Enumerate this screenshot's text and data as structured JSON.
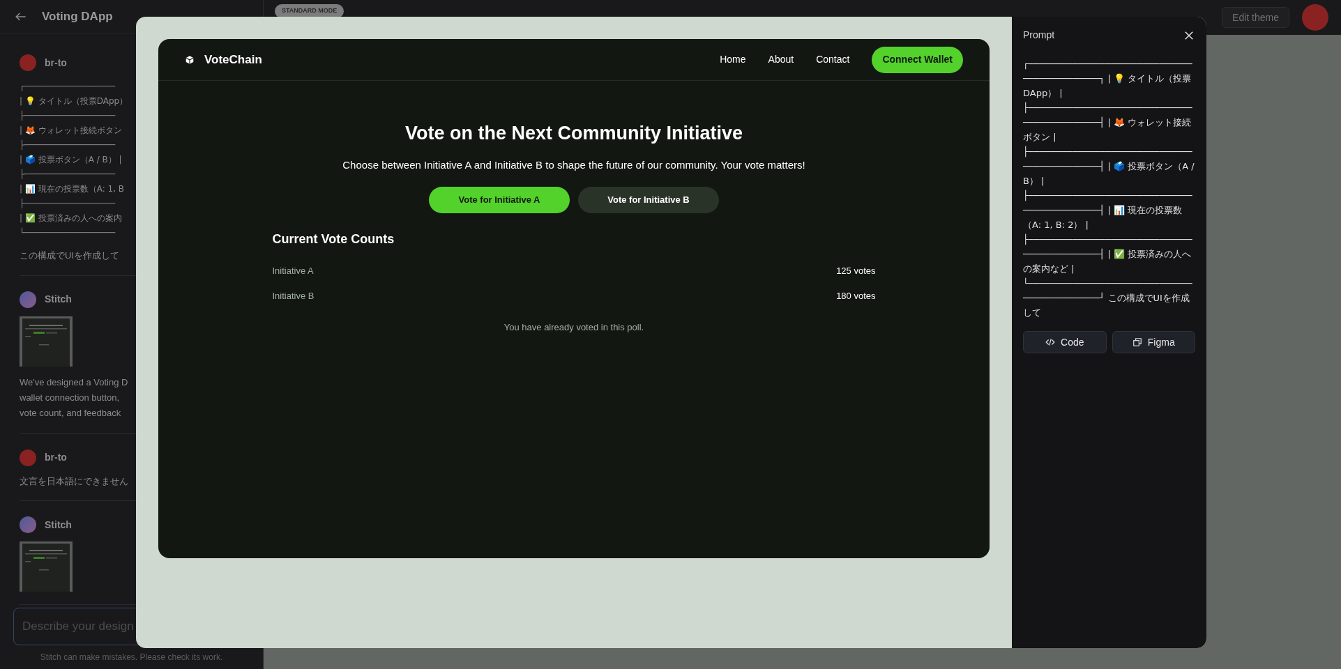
{
  "sidebar": {
    "title": "Voting DApp",
    "messages": [
      {
        "kind": "user",
        "author": "br-to",
        "box_lines": [
          "┌──────────────────",
          "| 💡 タイトル（投票DApp）",
          "├──────────────────",
          "| 🦊 ウォレット接続ボタン",
          "├──────────────────",
          "| 🗳️ 投票ボタン（A / B） |",
          "├──────────────────",
          "| 📊 現在の投票数（A: 1, B",
          "├──────────────────",
          "| ✅ 投票済みの人への案内",
          "└──────────────────"
        ],
        "text": "この構成でUIを作成して"
      },
      {
        "kind": "assistant",
        "author": "Stitch",
        "preview": {
          "kind": "picture"
        },
        "paragraph_lines": [
          "We've designed a Voting D",
          "wallet connection button,",
          "vote count, and feedback"
        ]
      },
      {
        "kind": "user",
        "author": "br-to",
        "text": "文言を日本語にできません"
      },
      {
        "kind": "assistant",
        "author": "Stitch",
        "preview": {
          "kind": "picture"
        }
      }
    ],
    "input": {
      "placeholder": "Describe your design"
    },
    "disclaimer": "Stitch can make mistakes. Please check its work."
  },
  "top_bar": {
    "mode_badge": "STANDARD MODE",
    "theme_button": "Edit theme"
  },
  "preview": {
    "brand": "VoteChain",
    "nav": [
      "Home",
      "About",
      "Contact"
    ],
    "connect_button": "Connect Wallet",
    "heading": "Vote on the Next Community Initiative",
    "subheading": "Choose between Initiative A and Initiative B to shape the future of our community. Your vote matters!",
    "vote_buttons": [
      {
        "label": "Vote for Initiative A",
        "kind": "primary"
      },
      {
        "label": "Vote for Initiative B",
        "kind": "secondary"
      }
    ],
    "counts_title": "Current Vote Counts",
    "counts": [
      {
        "name": "Initiative A",
        "votes": "125 votes"
      },
      {
        "name": "Initiative B",
        "votes": "180 votes"
      }
    ],
    "notice": "You have already voted in this poll."
  },
  "prompt_panel": {
    "title": "Prompt",
    "text": "┌────────────────────────────────────────────┐ | 💡 タイトル（投票DApp） | ├────────────────────────────────────────────┤ | 🦊 ウォレット接続ボタン | ├────────────────────────────────────────────┤ | 🗳️ 投票ボタン（A / B） | ├────────────────────────────────────────────┤ | 📊 現在の投票数（A: 1, B: 2） | ├────────────────────────────────────────────┤ | ✅ 投票済みの人への案内など | └────────────────────────────────────────────┘ この構成でUIを作成して",
    "buttons": [
      {
        "label": "Code",
        "kind": "code"
      },
      {
        "label": "Figma",
        "kind": "figma"
      }
    ]
  }
}
